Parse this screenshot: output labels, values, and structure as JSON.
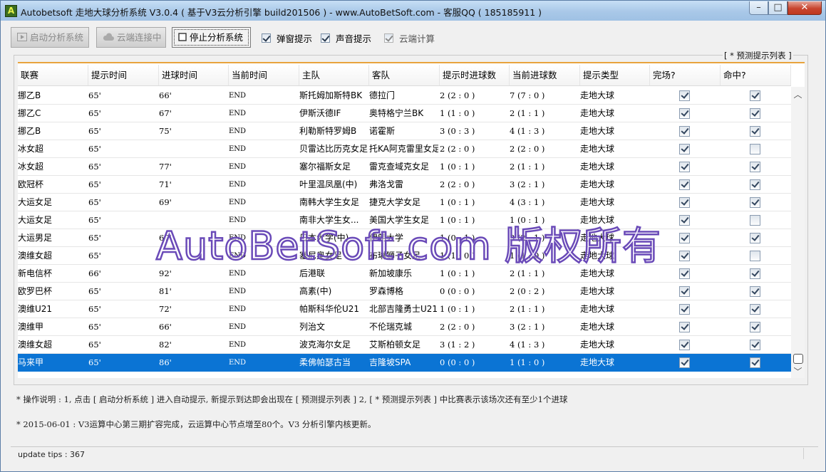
{
  "window": {
    "title": "Autobetsoft 走地大球分析系统 V3.0.4 ( 基于V3云分析引擎 build201506 ) - www.AutoBetSoft.com - 客服QQ ( 185185911 )",
    "controls": {
      "minimize": "–",
      "maximize": "□",
      "close": "✕"
    }
  },
  "toolbar": {
    "start_label": "启动分析系统",
    "cloud_label": "云端连接中",
    "stop_label": "停止分析系统",
    "popup_label": "弹窗提示",
    "sound_label": "声音提示",
    "cloud_calc_label": "云端计算"
  },
  "group_title": "[ * 预测提示列表 ]",
  "columns": [
    "联赛",
    "提示时间",
    "进球时间",
    "当前时间",
    "主队",
    "客队",
    "提示时进球数",
    "当前进球数",
    "提示类型",
    "完场?",
    "命中?"
  ],
  "rows": [
    {
      "league": "挪乙B",
      "tip_time": "65'",
      "goal_time": "66'",
      "cur_time": "END",
      "home": "斯托姆加斯特BK",
      "away": "德拉门",
      "tip_score": "2 (2 : 0 )",
      "cur_score": "7 (7 : 0 )",
      "type": "走地大球",
      "finished": true,
      "hit": true
    },
    {
      "league": "挪乙C",
      "tip_time": "65'",
      "goal_time": "67'",
      "cur_time": "END",
      "home": "伊斯沃德IF",
      "away": "奥特格宁兰BK",
      "tip_score": "1 (1 : 0 )",
      "cur_score": "2 (1 : 1 )",
      "type": "走地大球",
      "finished": true,
      "hit": true
    },
    {
      "league": "挪乙B",
      "tip_time": "65'",
      "goal_time": "75'",
      "cur_time": "END",
      "home": "利勒斯特罗姆B",
      "away": "诺霍斯",
      "tip_score": "3 (0 : 3 )",
      "cur_score": "4 (1 : 3 )",
      "type": "走地大球",
      "finished": true,
      "hit": true
    },
    {
      "league": "冰女超",
      "tip_time": "65'",
      "goal_time": "",
      "cur_time": "END",
      "home": "贝雷达比历克女足",
      "away": "托KA阿克雷里女足",
      "tip_score": "2 (2 : 0 )",
      "cur_score": "2 (2 : 0 )",
      "type": "走地大球",
      "finished": true,
      "hit": false
    },
    {
      "league": "冰女超",
      "tip_time": "65'",
      "goal_time": "77'",
      "cur_time": "END",
      "home": "塞尔福斯女足",
      "away": "雷克查域克女足",
      "tip_score": "1 (0 : 1 )",
      "cur_score": "2 (1 : 1 )",
      "type": "走地大球",
      "finished": true,
      "hit": true
    },
    {
      "league": "欧冠杯",
      "tip_time": "65'",
      "goal_time": "71'",
      "cur_time": "END",
      "home": "叶里温凤凰(中)",
      "away": "弗洛戈雷",
      "tip_score": "2 (2 : 0 )",
      "cur_score": "3 (2 : 1 )",
      "type": "走地大球",
      "finished": true,
      "hit": true
    },
    {
      "league": "大运女足",
      "tip_time": "65'",
      "goal_time": "69'",
      "cur_time": "END",
      "home": "南韩大学生女足",
      "away": "捷克大学女足",
      "tip_score": "1 (0 : 1 )",
      "cur_score": "4 (3 : 1 )",
      "type": "走地大球",
      "finished": true,
      "hit": true
    },
    {
      "league": "大运女足",
      "tip_time": "65'",
      "goal_time": "",
      "cur_time": "END",
      "home": "南非大学生女...",
      "away": "美国大学生女足",
      "tip_score": "1 (0 : 1 )",
      "cur_score": "1 (0 : 1 )",
      "type": "走地大球",
      "finished": true,
      "hit": false
    },
    {
      "league": "大运男足",
      "tip_time": "65'",
      "goal_time": "67'",
      "cur_time": "END",
      "home": "日本大学(中)",
      "away": "伊朗大学",
      "tip_score": "1 (0 : 1 )",
      "cur_score": "3 (2 : 1 )",
      "type": "走地大球",
      "finished": true,
      "hit": true
    },
    {
      "league": "澳维女超",
      "tip_time": "65'",
      "goal_time": "",
      "cur_time": "END",
      "home": "塞尼奥女足",
      "away": "布琳狮子女足",
      "tip_score": "1 (1 : 0 )",
      "cur_score": "1 (1 : 0 )",
      "type": "走地大球",
      "finished": true,
      "hit": false
    },
    {
      "league": "新电信杯",
      "tip_time": "66'",
      "goal_time": "92'",
      "cur_time": "END",
      "home": "后港联",
      "away": "新加坡康乐",
      "tip_score": "1 (0 : 1 )",
      "cur_score": "2 (1 : 1 )",
      "type": "走地大球",
      "finished": true,
      "hit": true
    },
    {
      "league": "欧罗巴杯",
      "tip_time": "65'",
      "goal_time": "81'",
      "cur_time": "END",
      "home": "高素(中)",
      "away": "罗森博格",
      "tip_score": "0 (0 : 0 )",
      "cur_score": "2 (0 : 2 )",
      "type": "走地大球",
      "finished": true,
      "hit": true
    },
    {
      "league": "澳维U21",
      "tip_time": "65'",
      "goal_time": "72'",
      "cur_time": "END",
      "home": "帕斯科华伦U21",
      "away": "北部吉隆勇士U21",
      "tip_score": "1 (0 : 1 )",
      "cur_score": "2 (1 : 1 )",
      "type": "走地大球",
      "finished": true,
      "hit": true
    },
    {
      "league": "澳维甲",
      "tip_time": "65'",
      "goal_time": "66'",
      "cur_time": "END",
      "home": "列治文",
      "away": "不伦瑞克城",
      "tip_score": "2 (2 : 0 )",
      "cur_score": "3 (2 : 1 )",
      "type": "走地大球",
      "finished": true,
      "hit": true
    },
    {
      "league": "澳维女超",
      "tip_time": "65'",
      "goal_time": "82'",
      "cur_time": "END",
      "home": "波克海尔女足",
      "away": "艾斯柏顿女足",
      "tip_score": "3 (1 : 2 )",
      "cur_score": "4 (1 : 3 )",
      "type": "走地大球",
      "finished": true,
      "hit": true
    },
    {
      "league": "马来甲",
      "tip_time": "65'",
      "goal_time": "86'",
      "cur_time": "END",
      "home": "柔佛帕瑟古当",
      "away": "吉隆坡SPA",
      "tip_score": "0 (0 : 0 )",
      "cur_score": "1 (1 : 0 )",
      "type": "走地大球",
      "finished": true,
      "hit": true,
      "selected": true
    }
  ],
  "watermark": "AutoBetSoft.com 版权所有",
  "info_line_1": "* 操作说明 : 1, 点击 [ 启动分析系统 ] 进入自动提示, 新提示到达即会出现在 [ 预测提示列表 ] 2, [ * 预测提示列表 ] 中比赛表示该场次还有至少1个进球",
  "info_line_2": "* 2015-06-01 :  V3运算中心第三期扩容完成，云运算中心节点增至80个。V3 分析引擎内核更新。",
  "status_text": "update tips : 367"
}
